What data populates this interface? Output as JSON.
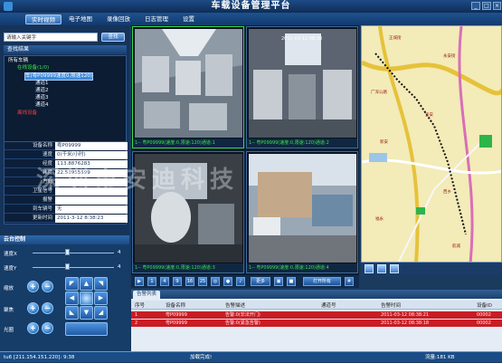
{
  "window": {
    "title": "车载设备管理平台"
  },
  "menu": {
    "items": [
      {
        "label": "实时视频"
      },
      {
        "label": "电子地图"
      },
      {
        "label": "录像回放"
      },
      {
        "label": "日志管理"
      },
      {
        "label": "设置"
      }
    ]
  },
  "search": {
    "placeholder": "请输入关键字",
    "button": "查找"
  },
  "results": {
    "title": "查找结果"
  },
  "tree": {
    "nodes": [
      {
        "label": "所有车辆"
      },
      {
        "label": "在线设备(1/0)"
      },
      {
        "label": "车(粤P09999速度0,限速120)"
      },
      {
        "label": "通道1"
      },
      {
        "label": "通道2"
      },
      {
        "label": "通道3"
      },
      {
        "label": "通道4"
      },
      {
        "label": "离线设备"
      }
    ]
  },
  "device_info": {
    "rows": [
      {
        "label": "设备名称",
        "value": "粤P09999"
      },
      {
        "label": "速度",
        "value": "0(千米/小时)"
      },
      {
        "label": "经度",
        "value": "113.8876283"
      },
      {
        "label": "纬度",
        "value": "22.53955599"
      },
      {
        "label": "方向",
        "value": ""
      },
      {
        "label": "卫星信号",
        "value": ""
      },
      {
        "label": "报警",
        "value": ""
      },
      {
        "label": "到车辆号",
        "value": "无"
      },
      {
        "label": "更新时间",
        "value": "2011-3-12 8:38:23"
      }
    ]
  },
  "ptz": {
    "title": "云台控制",
    "speed_x_label": "速度X",
    "speed_x_value": "4",
    "speed_y_label": "速度Y",
    "speed_y_value": "4",
    "zoom_label": "缩放",
    "focus_label": "聚焦",
    "iris_label": "光圈"
  },
  "videos": [
    {
      "caption": "1-- 粤P09999(速度:0,限速:120)通道:1",
      "timestamp": ""
    },
    {
      "caption": "1-- 粤P09999(速度:0,限速:120)通道:2",
      "timestamp": "2011-03-12 08:38"
    },
    {
      "caption": "1-- 粤P09999(速度:0,限速:120)通道:3",
      "timestamp": ""
    },
    {
      "caption": "1-- 粤P09999(速度:0,限速:120)通道:4",
      "timestamp": ""
    }
  ],
  "toolbar": {
    "layout_1": "1",
    "layout_4": "4",
    "layout_9": "9",
    "layout_16": "16",
    "layout_25": "25",
    "btn_ext": "更多",
    "btn_rec": "打开所有"
  },
  "map": {
    "places": [
      "正城街",
      "永安街",
      "广深公路",
      "宝安",
      "新安",
      "西乡",
      "福永",
      "航城"
    ]
  },
  "alarm": {
    "tab": "告警列表",
    "headers": [
      "序号",
      "设备名称",
      "告警描述",
      "通道号",
      "告警时间",
      "设备ID"
    ],
    "rows": [
      [
        "1",
        "粤P09999",
        "告警:0(非法开门)",
        "",
        "2011-03-12 08:38:21",
        "00002"
      ],
      [
        "2",
        "粤P09999",
        "告警:0(紧急告警)",
        "",
        "2011-03-12 08:38:18",
        "00002"
      ]
    ]
  },
  "status": {
    "user": "tu6 [211.154.151.220]: 9:38",
    "loaded": "加载完成!",
    "flow": "流量:181 KB"
  },
  "watermark": "深圳市安迪科技"
}
